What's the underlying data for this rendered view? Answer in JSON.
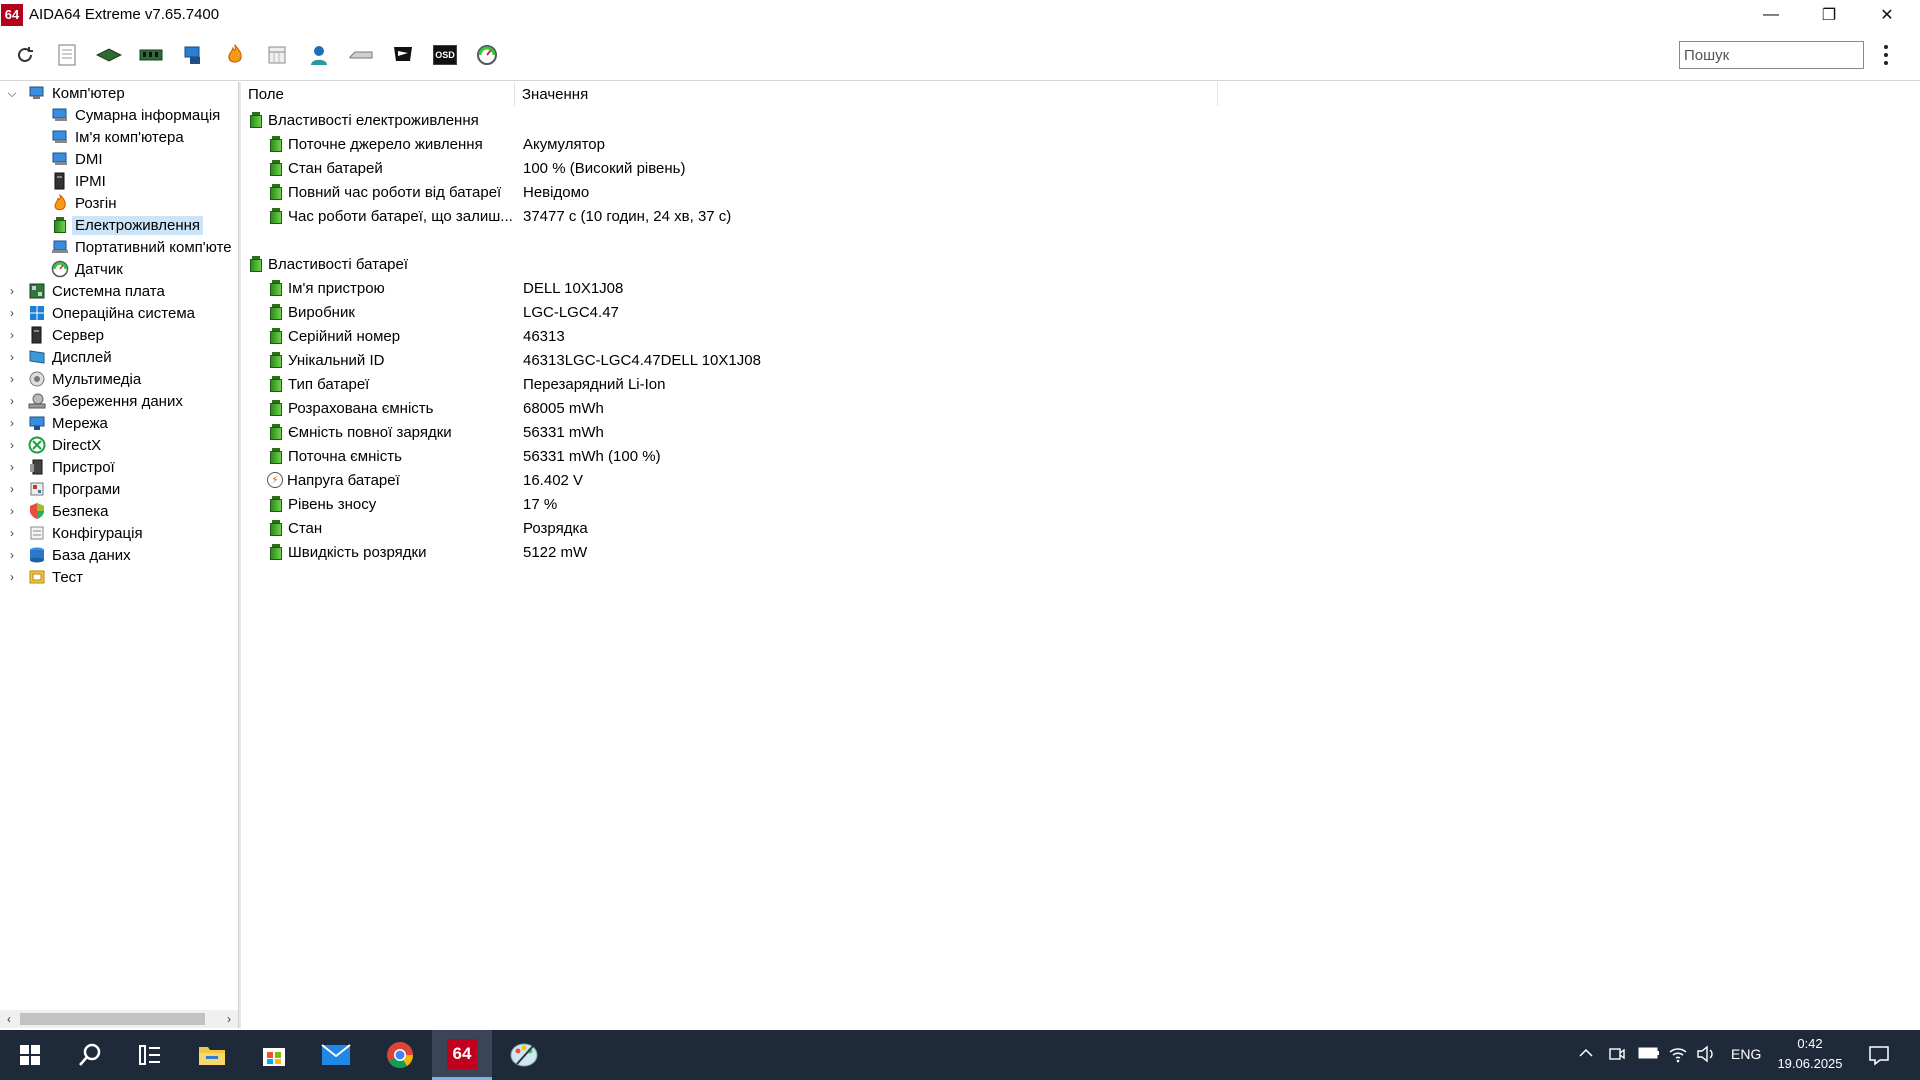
{
  "window": {
    "logo": "64",
    "title": "AIDA64 Extreme v7.65.7400",
    "minimize": "—",
    "maximize": "❐",
    "close": "✕"
  },
  "toolbar": {
    "icons": [
      "refresh-icon",
      "report-icon",
      "motherboard-icon",
      "memory-icon",
      "network-icon",
      "flame-icon",
      "calendar-icon",
      "user-icon",
      "drive-icon",
      "flag-icon",
      "osd-icon",
      "sensor-gauge-icon"
    ],
    "osd_label": "OSD",
    "search_placeholder": "Пошук"
  },
  "tree": {
    "root": {
      "label": "Комп'ютер",
      "icon": "computer-icon"
    },
    "children": [
      {
        "label": "Сумарна інформація",
        "icon": "computer-icon"
      },
      {
        "label": "Ім'я комп'ютера",
        "icon": "computer-icon"
      },
      {
        "label": "DMI",
        "icon": "computer-icon"
      },
      {
        "label": "IPMI",
        "icon": "server-icon"
      },
      {
        "label": "Розгін",
        "icon": "flame-icon"
      },
      {
        "label": "Електроживлення",
        "icon": "battery-icon",
        "selected": true
      },
      {
        "label": "Портативний комп'юте",
        "icon": "laptop-icon"
      },
      {
        "label": "Датчик",
        "icon": "gauge-icon"
      }
    ],
    "categories": [
      {
        "label": "Системна плата",
        "icon": "motherboard-icon"
      },
      {
        "label": "Операційна система",
        "icon": "windows-icon"
      },
      {
        "label": "Сервер",
        "icon": "server-icon"
      },
      {
        "label": "Дисплей",
        "icon": "display-icon"
      },
      {
        "label": "Мультимедіа",
        "icon": "speaker-icon"
      },
      {
        "label": "Збереження даних",
        "icon": "storage-icon"
      },
      {
        "label": "Мережа",
        "icon": "network-icon"
      },
      {
        "label": "DirectX",
        "icon": "xbox-icon"
      },
      {
        "label": "Пристрої",
        "icon": "devices-icon"
      },
      {
        "label": "Програми",
        "icon": "programs-icon"
      },
      {
        "label": "Безпека",
        "icon": "shield-icon"
      },
      {
        "label": "Конфігурація",
        "icon": "config-icon"
      },
      {
        "label": "База даних",
        "icon": "database-icon"
      },
      {
        "label": "Тест",
        "icon": "benchmark-icon"
      }
    ]
  },
  "details": {
    "columns": [
      "Поле",
      "Значення"
    ],
    "groups": [
      {
        "title": "Властивості електроживлення",
        "rows": [
          {
            "field": "Поточне джерело живлення",
            "value": "Акумулятор"
          },
          {
            "field": "Стан батарей",
            "value": "100 % (Високий рівень)"
          },
          {
            "field": "Повний час роботи від батареї",
            "value": "Невідомо"
          },
          {
            "field": "Час роботи батареї, що залиш...",
            "value": "37477 с (10 годин, 24 хв, 37 с)"
          }
        ]
      },
      {
        "title": "Властивості батареї",
        "rows": [
          {
            "field": "Ім'я пристрою",
            "value": "DELL 10X1J08"
          },
          {
            "field": "Виробник",
            "value": "LGC-LGC4.47"
          },
          {
            "field": "Серійний номер",
            "value": "46313"
          },
          {
            "field": "Унікальний ID",
            "value": "46313LGC-LGC4.47DELL 10X1J08"
          },
          {
            "field": "Тип батареї",
            "value": "Перезарядний Li-Ion"
          },
          {
            "field": "Розрахована ємність",
            "value": "68005 mWh"
          },
          {
            "field": "Ємність повної зарядки",
            "value": "56331 mWh"
          },
          {
            "field": "Поточна ємність",
            "value": "56331 mWh  (100 %)"
          },
          {
            "field": "Напруга батареї",
            "value": "16.402 V",
            "icon": "voltage-icon"
          },
          {
            "field": "Рівень зносу",
            "value": "17 %"
          },
          {
            "field": "Стан",
            "value": "Розрядка"
          },
          {
            "field": "Швидкість розрядки",
            "value": "5122 mW"
          }
        ]
      }
    ]
  },
  "taskbar": {
    "apps": [
      "start-icon",
      "search-icon",
      "task-view-icon",
      "file-explorer-icon",
      "store-icon",
      "mail-icon",
      "chrome-icon",
      "aida64-icon",
      "paint-icon"
    ],
    "aida_label": "64",
    "tray": {
      "language": "ENG",
      "time": "0:42",
      "date": "19.06.2025"
    }
  }
}
